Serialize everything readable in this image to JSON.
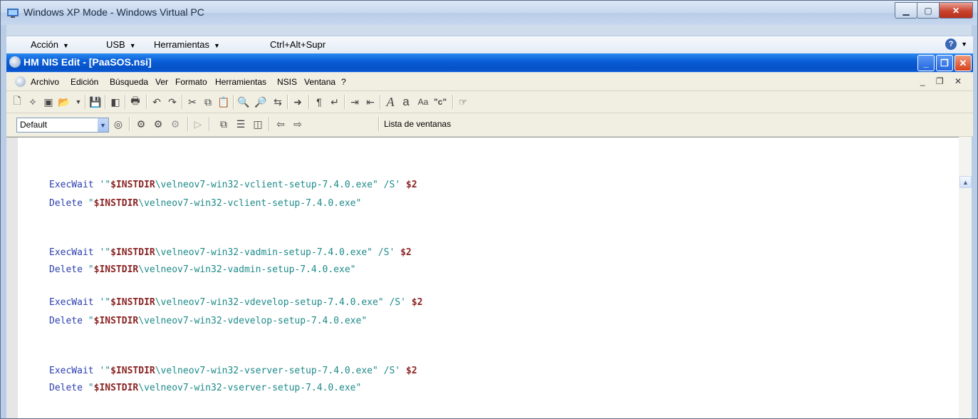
{
  "vpc_window": {
    "title": "Windows XP Mode - Windows Virtual PC",
    "menu": [
      "Acción",
      "USB",
      "Herramientas",
      "Ctrl+Alt+Supr"
    ]
  },
  "app_window": {
    "title": "HM NIS Edit - [PaaSOS.nsi]",
    "menu": [
      "Archivo",
      "Edición",
      "Búsqueda",
      "Ver",
      "Formato",
      "Herramientas",
      "NSIS",
      "Ventana",
      "?"
    ]
  },
  "toolbar2": {
    "style_value": "Default",
    "window_list_label": "Lista de ventanas"
  },
  "icons": {
    "toolbar1": [
      "new-file-icon",
      "new-template-icon",
      "save-all-icon",
      "open-icon",
      "save-icon",
      "copy-compile-icon",
      "print-icon",
      "undo-icon",
      "redo-icon",
      "cut-icon",
      "copy-icon",
      "paste-icon",
      "find-icon",
      "find-next-icon",
      "replace-icon",
      "goto-icon",
      "paragraph-icon",
      "wordwrap-icon",
      "indent-icon",
      "outdent-icon",
      "font-icon",
      "lowercase-icon",
      "uppercase-icon",
      "quote-icon",
      "comment-icon"
    ],
    "toolbar2": [
      "preview-icon",
      "compile-icon",
      "compile-run-icon",
      "compile-stop-icon",
      "run-icon",
      "cascade-icon",
      "tile-horizontal-icon",
      "tile-vertical-icon",
      "prev-window-icon",
      "next-window-icon"
    ]
  },
  "code": [
    {
      "kw": "ExecWait",
      "pre": " '\"",
      "var": "$INSTDIR",
      "path": "\\velneov7-win32-vclient-setup-7.4.0.exe\" /S'",
      "num": " $2"
    },
    {
      "kw": "Delete",
      "pre": " \"",
      "var": "$INSTDIR",
      "path": "\\velneov7-win32-vclient-setup-7.4.0.exe\"",
      "num": ""
    },
    {
      "kw": "ExecWait",
      "pre": " '\"",
      "var": "$INSTDIR",
      "path": "\\velneov7-win32-vadmin-setup-7.4.0.exe\" /S'",
      "num": " $2"
    },
    {
      "kw": "Delete",
      "pre": " \"",
      "var": "$INSTDIR",
      "path": "\\velneov7-win32-vadmin-setup-7.4.0.exe\"",
      "num": ""
    },
    {
      "kw": "ExecWait",
      "pre": " '\"",
      "var": "$INSTDIR",
      "path": "\\velneov7-win32-vdevelop-setup-7.4.0.exe\" /S'",
      "num": " $2"
    },
    {
      "kw": "Delete",
      "pre": " \"",
      "var": "$INSTDIR",
      "path": "\\velneov7-win32-vdevelop-setup-7.4.0.exe\"",
      "num": ""
    },
    {
      "kw": "ExecWait",
      "pre": " '\"",
      "var": "$INSTDIR",
      "path": "\\velneov7-win32-vserver-setup-7.4.0.exe\" /S'",
      "num": " $2"
    },
    {
      "kw": "Delete",
      "pre": " \"",
      "var": "$INSTDIR",
      "path": "\\velneov7-win32-vserver-setup-7.4.0.exe\"",
      "num": ""
    }
  ]
}
